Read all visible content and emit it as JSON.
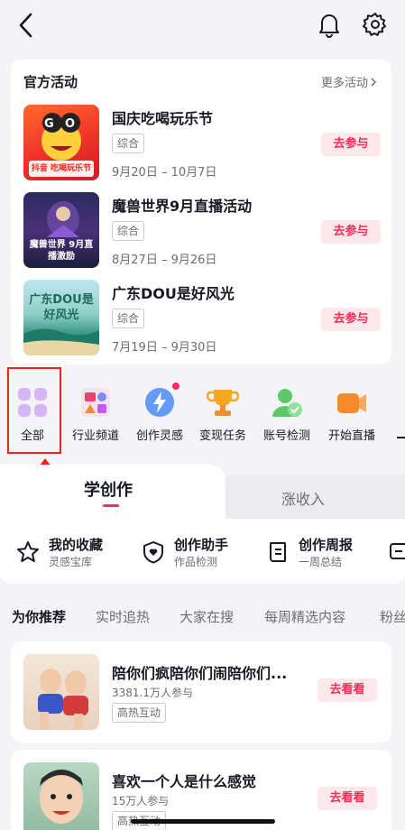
{
  "official": {
    "title": "官方活动",
    "more": "更多活动",
    "items": [
      {
        "name": "国庆吃喝玩乐节",
        "tag": "综合",
        "date": "9月20日 – 10月7日",
        "button": "去参与",
        "thumb_caption": "抖音 吃喝玩乐节"
      },
      {
        "name": "魔兽世界9月直播活动",
        "tag": "综合",
        "date": "8月27日 – 9月26日",
        "button": "去参与",
        "thumb_caption": "魔兽世界 9月直播激励"
      },
      {
        "name": "广东DOU是好风光",
        "tag": "综合",
        "date": "7月19日 – 9月30日",
        "button": "去参与",
        "thumb_caption": "广东DOU是好风光"
      }
    ]
  },
  "quick": [
    {
      "label": "全部",
      "icon": "grid-icon"
    },
    {
      "label": "行业频道",
      "icon": "channel-icon"
    },
    {
      "label": "创作灵感",
      "icon": "lightning-icon"
    },
    {
      "label": "变现任务",
      "icon": "trophy-icon"
    },
    {
      "label": "账号检测",
      "icon": "user-check-icon"
    },
    {
      "label": "开始直播",
      "icon": "camera-icon"
    }
  ],
  "section_tabs": {
    "learn": "学创作",
    "earn": "涨收入"
  },
  "tools": [
    {
      "name": "我的收藏",
      "sub": "灵感宝库",
      "icon": "star-icon"
    },
    {
      "name": "创作助手",
      "sub": "作品检测",
      "icon": "shield-heart-icon"
    },
    {
      "name": "创作周报",
      "sub": "一周总结",
      "icon": "report-icon"
    }
  ],
  "feed_tabs": [
    "为你推荐",
    "实时追热",
    "大家在搜",
    "每周精选内容",
    "粉丝"
  ],
  "recommendations": [
    {
      "title": "陪你们疯陪你们闹陪你们...",
      "participants": "3381.1万人参与",
      "tag": "高热互动",
      "button": "去看看"
    },
    {
      "title": "喜欢一个人是什么感觉",
      "participants": "15万人参与",
      "tag": "高热互动",
      "button": "去看看"
    }
  ],
  "colors": {
    "accent": "#fe2c55",
    "highlight_box": "#e8251d"
  }
}
